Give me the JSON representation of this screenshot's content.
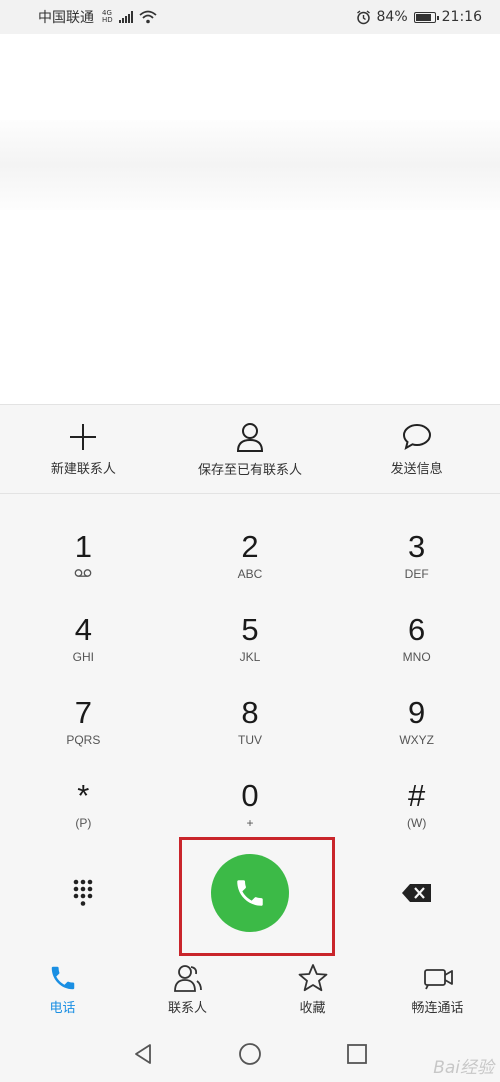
{
  "status": {
    "carrier": "中国联通",
    "net_top": "4G",
    "net_bottom": "HD",
    "battery": "84%",
    "time": "21:16"
  },
  "actions": [
    {
      "label": "新建联系人",
      "icon": "plus-icon"
    },
    {
      "label": "保存至已有联系人",
      "icon": "person-icon"
    },
    {
      "label": "发送信息",
      "icon": "message-icon"
    }
  ],
  "keypad": {
    "rows": [
      [
        {
          "digit": "1",
          "letters": ""
        },
        {
          "digit": "2",
          "letters": "ABC"
        },
        {
          "digit": "3",
          "letters": "DEF"
        }
      ],
      [
        {
          "digit": "4",
          "letters": "GHI"
        },
        {
          "digit": "5",
          "letters": "JKL"
        },
        {
          "digit": "6",
          "letters": "MNO"
        }
      ],
      [
        {
          "digit": "7",
          "letters": "PQRS"
        },
        {
          "digit": "8",
          "letters": "TUV"
        },
        {
          "digit": "9",
          "letters": "WXYZ"
        }
      ],
      [
        {
          "digit": "*",
          "letters": "(P)"
        },
        {
          "digit": "0",
          "letters": "+"
        },
        {
          "digit": "#",
          "letters": "(W)"
        }
      ]
    ]
  },
  "tabs": [
    {
      "label": "电话",
      "active": true
    },
    {
      "label": "联系人",
      "active": false
    },
    {
      "label": "收藏",
      "active": false
    },
    {
      "label": "畅连通话",
      "active": false
    }
  ],
  "watermark": "Bai经验",
  "colors": {
    "accent": "#1a8fe3",
    "call": "#3cba47",
    "highlight": "#c9252b"
  }
}
